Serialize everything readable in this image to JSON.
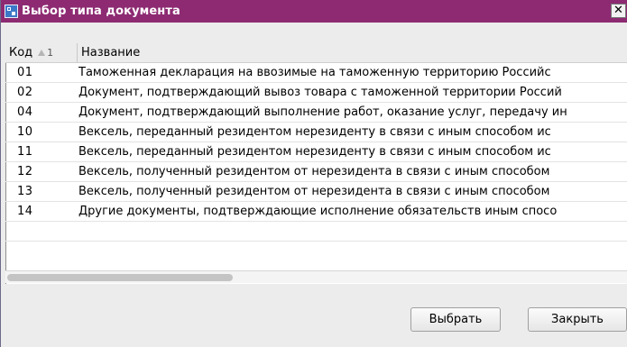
{
  "window": {
    "title": "Выбор типа документа",
    "close_symbol": "✕"
  },
  "table": {
    "columns": {
      "code": "Код",
      "sort_index": "1",
      "name": "Название"
    },
    "rows": [
      {
        "code": "01",
        "name": "Таможенная декларация на ввозимые на таможенную территорию Российс"
      },
      {
        "code": "02",
        "name": "Документ, подтверждающий вывоз товара с таможенной территории Россий"
      },
      {
        "code": "04",
        "name": "Документ, подтверждающий выполнение работ, оказание услуг, передачу ин"
      },
      {
        "code": "10",
        "name": "Вексель, переданный резидентом нерезиденту в связи с иным способом ис"
      },
      {
        "code": "11",
        "name": "Вексель, переданный резидентом нерезиденту в связи с иным способом ис"
      },
      {
        "code": "12",
        "name": "Вексель, полученный резидентом от нерезидента в связи с иным способом"
      },
      {
        "code": "13",
        "name": "Вексель, полученный резидентом от нерезидента в связи с иным способом"
      },
      {
        "code": "14",
        "name": "Другие документы, подтверждающие исполнение обязательств иным спосо"
      }
    ]
  },
  "buttons": {
    "select_label": "Выбрать",
    "close_label": "Закрыть"
  },
  "icons": {
    "app": "document-type-icon",
    "sort": "sort-ascending-icon"
  }
}
